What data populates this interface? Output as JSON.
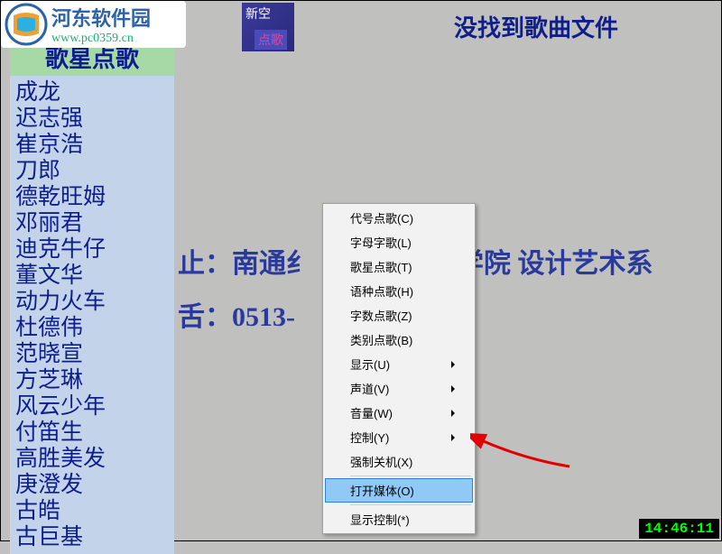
{
  "watermark": {
    "title": "河东软件园",
    "url": "www.pc0359.cn"
  },
  "top_logo": {
    "line1": "新空",
    "line2": "点歌"
  },
  "error_message": "没找到歌曲文件",
  "sidebar": {
    "title": "歌星点歌",
    "items": [
      "成龙",
      "迟志强",
      "崔京浩",
      "刀郎",
      "德乾旺姆",
      "邓丽君",
      "迪克牛仔",
      "董文华",
      "动力火车",
      "杜德伟",
      "范晓宣",
      "方芝琳",
      "风云少年",
      "付笛生",
      "高胜美发",
      "庚澄发",
      "古皓",
      "古巨基"
    ]
  },
  "background": {
    "line1_left": "止：南通纟",
    "line1_right": "术学院  设计艺术系",
    "line2_left": "舌：0513-"
  },
  "context_menu": {
    "items": [
      {
        "label": "代号点歌(C)",
        "submenu": false
      },
      {
        "label": "字母字歌(L)",
        "submenu": false
      },
      {
        "label": "歌星点歌(T)",
        "submenu": false
      },
      {
        "label": "语种点歌(H)",
        "submenu": false
      },
      {
        "label": "字数点歌(Z)",
        "submenu": false
      },
      {
        "label": "类别点歌(B)",
        "submenu": false
      },
      {
        "label": "显示(U)",
        "submenu": true
      },
      {
        "label": "声道(V)",
        "submenu": true
      },
      {
        "label": "音量(W)",
        "submenu": true
      },
      {
        "label": "控制(Y)",
        "submenu": true
      },
      {
        "label": "强制关机(X)",
        "submenu": false
      }
    ],
    "highlighted": "打开媒体(O)",
    "bottom": "显示控制(*)"
  },
  "clock": "14:46:11"
}
